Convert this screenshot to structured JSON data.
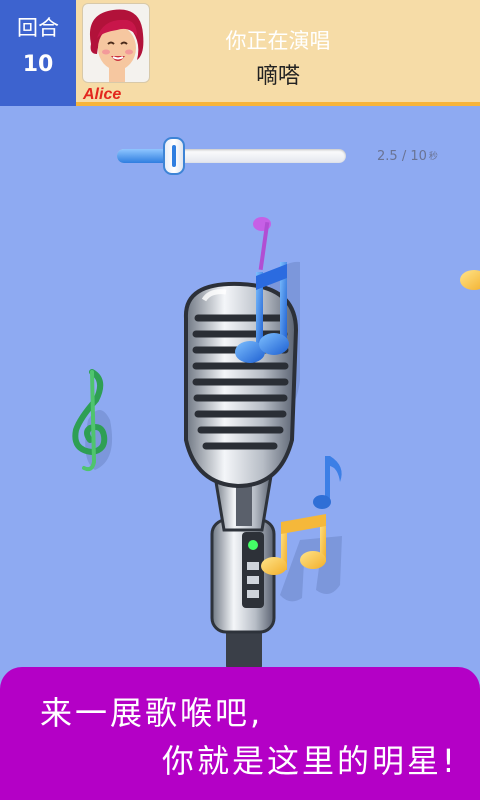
{
  "header": {
    "round_label": "回合",
    "round_number": "10",
    "player_name": "Alice",
    "now_singing_label": "你正在演唱",
    "song_title": "嘀嗒"
  },
  "progress": {
    "elapsed": "2.5",
    "total": "10",
    "unit": "秒",
    "fraction": 0.25
  },
  "banner": {
    "line1": "来一展歌喉吧,",
    "line2": "你就是这里的明星!"
  },
  "icons": [
    "avatar-girl",
    "microphone-icon",
    "music-note-icon",
    "treble-clef-icon"
  ],
  "colors": {
    "background": "#8eaaf2",
    "header_blue": "#3d63cf",
    "banner": "#b400c6",
    "name_red": "#e3261e"
  }
}
